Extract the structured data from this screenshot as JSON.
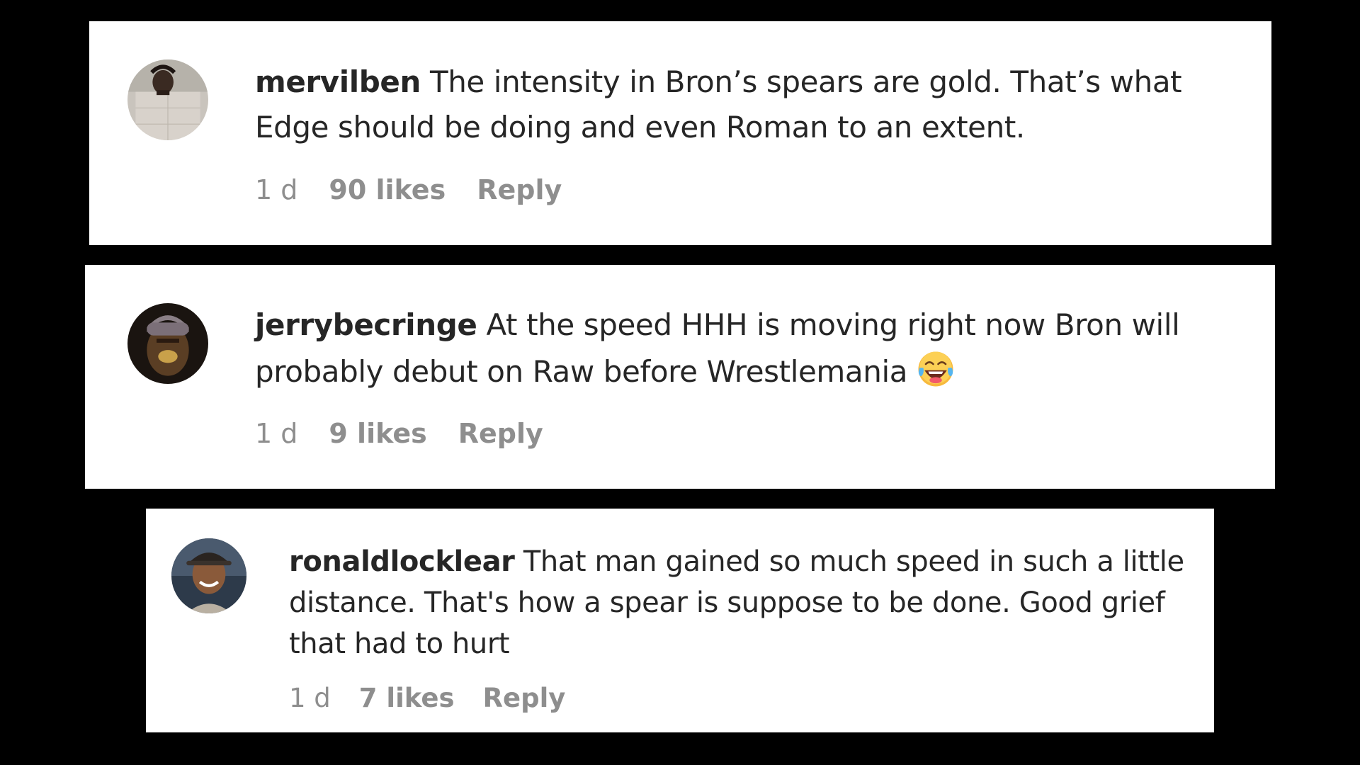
{
  "comments": [
    {
      "username": "mervilben",
      "text": "The intensity in Bron’s spears are gold. That’s what Edge should be doing and even Roman to an extent.",
      "time": "1 d",
      "likes": "90 likes",
      "reply": "Reply",
      "avatar": "user-photo-icon"
    },
    {
      "username": "jerrybecringe",
      "text": "At the speed HHH is moving right now Bron will probably debut on Raw before Wrestlemania",
      "emoji": "tears-of-joy-emoji-icon",
      "time": "1 d",
      "likes": "9 likes",
      "reply": "Reply",
      "avatar": "user-photo-icon"
    },
    {
      "username": "ronaldlocklear",
      "text": "That man gained so much speed in such a little distance. That's how a spear is suppose to be done. Good grief that had to hurt",
      "time": "1 d",
      "likes": "7 likes",
      "reply": "Reply",
      "avatar": "user-photo-icon"
    }
  ],
  "colors": {
    "background": "#000000",
    "card": "#ffffff",
    "text": "#262626",
    "meta": "#8e8e8e"
  }
}
